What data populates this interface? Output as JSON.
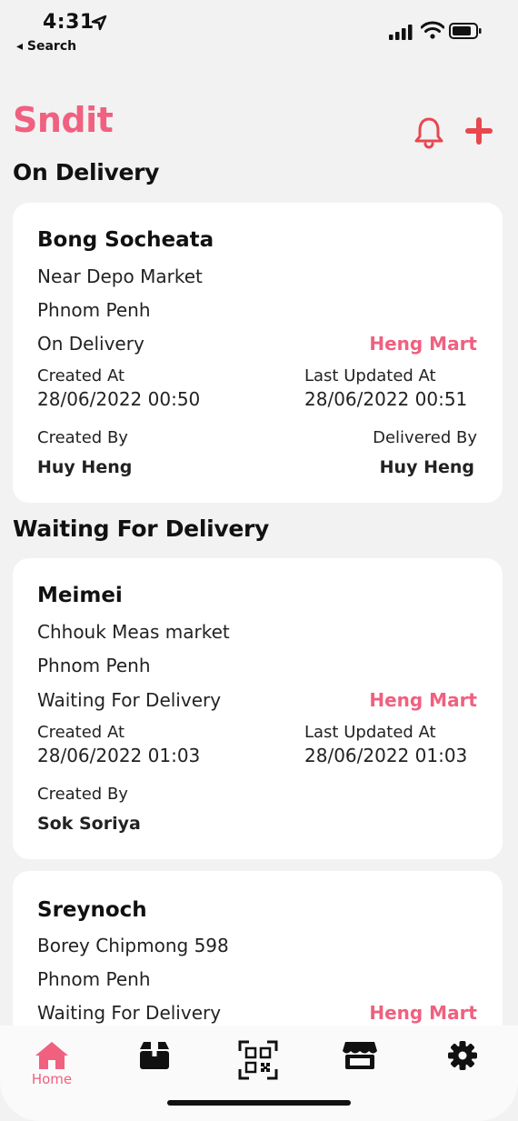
{
  "status_bar": {
    "time": "4:31",
    "back_label": "◂ Search"
  },
  "header": {
    "brand": "Sndit"
  },
  "sections": {
    "on_delivery": {
      "title": "On Delivery"
    },
    "waiting": {
      "title": "Waiting For Delivery"
    }
  },
  "orders": [
    {
      "name": "Bong Socheata",
      "address": "Near Depo Market",
      "city": "Phnom Penh",
      "status": "On Delivery",
      "store": "Heng Mart",
      "created_at_label": "Created At",
      "created_at": "28/06/2022 00:50",
      "updated_at_label": "Last Updated At",
      "updated_at": "28/06/2022 00:51",
      "created_by_label": "Created By",
      "created_by": "Huy Heng",
      "delivered_by_label": "Delivered By",
      "delivered_by": "Huy Heng"
    },
    {
      "name": "Meimei",
      "address": "Chhouk Meas market",
      "city": "Phnom Penh",
      "status": "Waiting For Delivery",
      "store": "Heng Mart",
      "created_at_label": "Created At",
      "created_at": "28/06/2022 01:03",
      "updated_at_label": "Last Updated At",
      "updated_at": "28/06/2022 01:03",
      "created_by_label": "Created By",
      "created_by": "Sok Soriya"
    },
    {
      "name": "Sreynoch",
      "address": "Borey Chipmong 598",
      "city": "Phnom Penh",
      "status": "Waiting For Delivery",
      "store": "Heng Mart"
    }
  ],
  "tabbar": {
    "items": [
      {
        "label": "Home",
        "icon": "home-icon",
        "active": true
      },
      {
        "label": "",
        "icon": "package-icon"
      },
      {
        "label": "",
        "icon": "qr-code-icon"
      },
      {
        "label": "",
        "icon": "store-icon"
      },
      {
        "label": "",
        "icon": "gear-icon"
      }
    ]
  },
  "colors": {
    "accent": "#f0607f",
    "background": "#f2f2f2",
    "card": "#ffffff"
  }
}
